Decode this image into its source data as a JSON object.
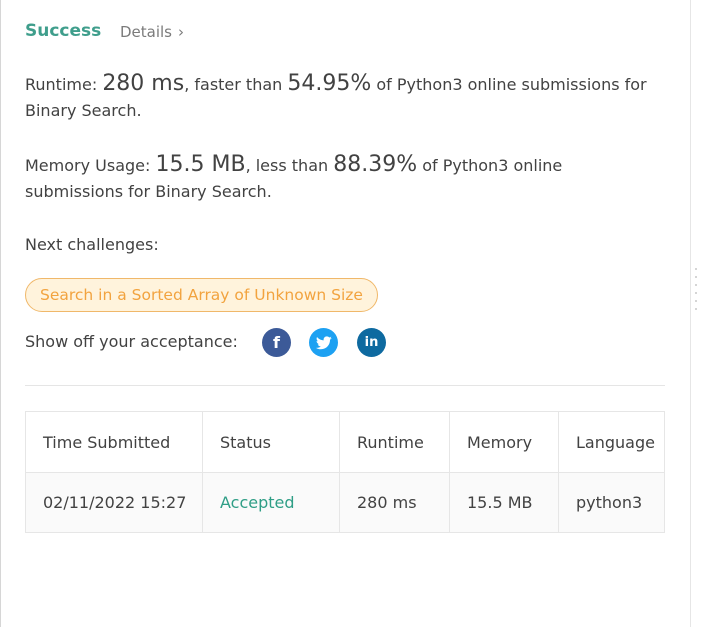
{
  "header": {
    "status": "Success",
    "details_label": "Details",
    "details_chevron": "›"
  },
  "runtime": {
    "label": "Runtime:",
    "value": "280 ms",
    "comparison": ", faster than",
    "percent": "54.95%",
    "suffix": "of Python3 online submissions for Binary Search."
  },
  "memory": {
    "label": "Memory Usage:",
    "value": "15.5 MB",
    "comparison": ", less than",
    "percent": "88.39%",
    "suffix": "of Python3 online submissions for Binary Search."
  },
  "next_challenges": {
    "label": "Next challenges:",
    "items": [
      "Search in a Sorted Array of Unknown Size"
    ]
  },
  "share": {
    "label": "Show off your acceptance:",
    "icons": [
      "facebook-icon",
      "twitter-icon",
      "linkedin-icon"
    ]
  },
  "submissions": {
    "headers": [
      "Time Submitted",
      "Status",
      "Runtime",
      "Memory",
      "Language"
    ],
    "rows": [
      {
        "time": "02/11/2022 15:27",
        "status": "Accepted",
        "runtime": "280 ms",
        "memory": "15.5 MB",
        "language": "python3"
      }
    ]
  },
  "colors": {
    "success": "#3f9e8c",
    "accepted": "#2f9e86",
    "challenge_text": "#f2a33f",
    "challenge_bg": "#fff3dc",
    "facebook": "#3c5a98",
    "twitter": "#1da1f2",
    "linkedin": "#0e6aa0"
  }
}
